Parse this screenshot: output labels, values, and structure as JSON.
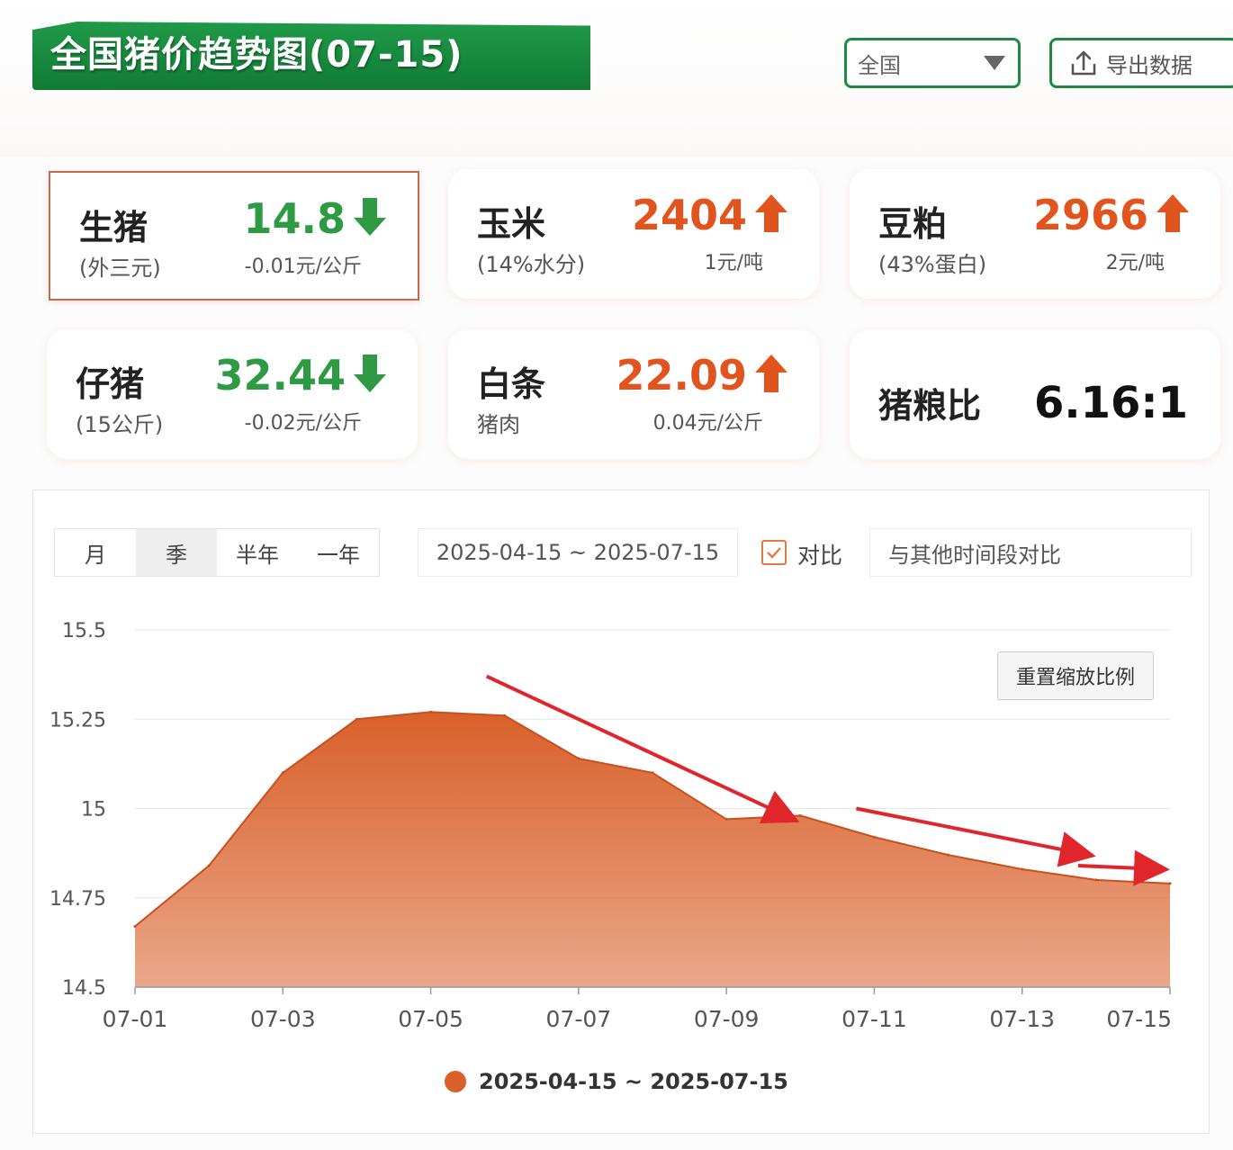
{
  "header": {
    "title": "全国猪价趋势图(07-15)",
    "region_value": "全国",
    "export_label": "导出数据"
  },
  "cards": [
    {
      "name": "生猪",
      "sub": "(外三元)",
      "value": "14.8",
      "trend": "down",
      "change": "-0.01元/公斤"
    },
    {
      "name": "玉米",
      "sub": "(14%水分)",
      "value": "2404",
      "trend": "up",
      "change": "1元/吨"
    },
    {
      "name": "豆粕",
      "sub": "(43%蛋白)",
      "value": "2966",
      "trend": "up",
      "change": "2元/吨"
    },
    {
      "name": "仔猪",
      "sub": "(15公斤)",
      "value": "32.44",
      "trend": "down",
      "change": "-0.02元/公斤"
    },
    {
      "name": "白条",
      "sub": "猪肉",
      "value": "22.09",
      "trend": "up",
      "change": "0.04元/公斤"
    }
  ],
  "ratio": {
    "name": "猪粮比",
    "value": "6.16:1"
  },
  "controls": {
    "tabs": [
      "月",
      "季",
      "半年",
      "一年"
    ],
    "selected_tab": "季",
    "date_range": "2025-04-15 ~ 2025-07-15",
    "compare_label": "对比",
    "compare_placeholder": "与其他时间段对比",
    "reset_zoom": "重置缩放比例"
  },
  "colors": {
    "brand_green": "#1d8a40",
    "area_fill": "#d9602a",
    "down": "#2e9a43",
    "up": "#e2541e",
    "annotation_arrow": "#e0262a"
  },
  "chart_data": {
    "type": "area",
    "x": [
      "07-01",
      "07-02",
      "07-03",
      "07-04",
      "07-05",
      "07-06",
      "07-07",
      "07-08",
      "07-09",
      "07-10",
      "07-11",
      "07-12",
      "07-13",
      "07-14",
      "07-15"
    ],
    "series": [
      {
        "name": "2025-04-15 ~ 2025-07-15",
        "values": [
          14.67,
          14.84,
          15.1,
          15.25,
          15.27,
          15.26,
          15.14,
          15.1,
          14.97,
          14.98,
          14.92,
          14.87,
          14.83,
          14.8,
          14.79
        ]
      }
    ],
    "xticks": [
      "07-01",
      "07-03",
      "07-05",
      "07-07",
      "07-09",
      "07-11",
      "07-13",
      "07-15"
    ],
    "yticks": [
      "14.5",
      "14.75",
      "15",
      "15.25",
      "15.5"
    ],
    "ylim": [
      14.5,
      15.5
    ],
    "grid": true,
    "legend": "bottom-center",
    "annotations": [
      {
        "type": "arrow",
        "from": [
          "07-06",
          15.37
        ],
        "to": [
          "07-10",
          14.97
        ]
      },
      {
        "type": "arrow",
        "from": [
          "07-11",
          15.0
        ],
        "to": [
          "07-14",
          14.87
        ]
      },
      {
        "type": "arrow",
        "from": [
          "07-14",
          14.84
        ],
        "to": [
          "07-15",
          14.83
        ]
      }
    ]
  }
}
